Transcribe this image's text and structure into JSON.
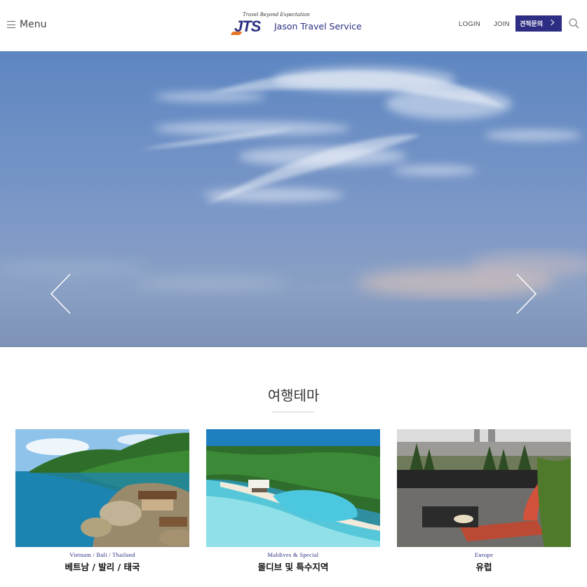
{
  "header": {
    "menu_label": "Menu",
    "logo_tagline": "Travel Beyond Expectation",
    "logo_mark": "JTS",
    "logo_name": "Jason Travel Service",
    "login_label": "LOGIN",
    "join_label": "JOIN",
    "quote_label": "견적문의"
  },
  "hero": {
    "prev": "prev-arrow",
    "next": "next-arrow"
  },
  "themes": {
    "title": "여행테마",
    "cards": [
      {
        "subtitle": "Vietnam / Bali / Thailand",
        "title": "베트남 / 발리 / 태국"
      },
      {
        "subtitle": "Maldives & Special",
        "title": "몰디브 및 특수지역"
      },
      {
        "subtitle": "Europe",
        "title": "유럽"
      }
    ]
  },
  "colors": {
    "brand": "#2c2d83",
    "accent": "#e8762a"
  }
}
